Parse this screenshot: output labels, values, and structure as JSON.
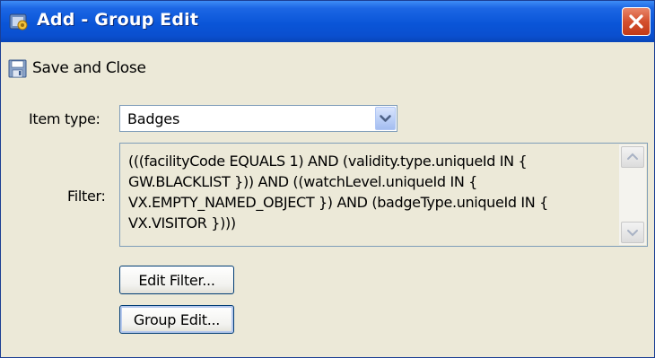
{
  "window": {
    "title": "Add - Group Edit"
  },
  "toolbar": {
    "save_label": "Save and Close"
  },
  "form": {
    "item_type_label": "Item type:",
    "item_type_value": "Badges",
    "filter_label": "Filter:",
    "filter_text": "(((facilityCode EQUALS 1) AND (validity.type.uniqueId IN {\nGW.BLACKLIST })) AND ((watchLevel.uniqueId IN {\nVX.EMPTY_NAMED_OBJECT }) AND (badgeType.uniqueId IN {\nVX.VISITOR })))",
    "edit_filter_label": "Edit Filter...",
    "group_edit_label": "Group Edit..."
  },
  "icons": {
    "title": "group-edit-icon",
    "close": "close-icon",
    "save": "floppy-disk-icon",
    "dropdown": "chevron-down-icon",
    "scroll_up": "scroll-up-arrow-icon",
    "scroll_down": "scroll-down-arrow-icon"
  },
  "colors": {
    "title_bar": "#0a55d8",
    "close_button": "#d4502e",
    "dialog_background": "#ece9d8",
    "field_border": "#7f9db9",
    "button_border": "#003c74"
  }
}
